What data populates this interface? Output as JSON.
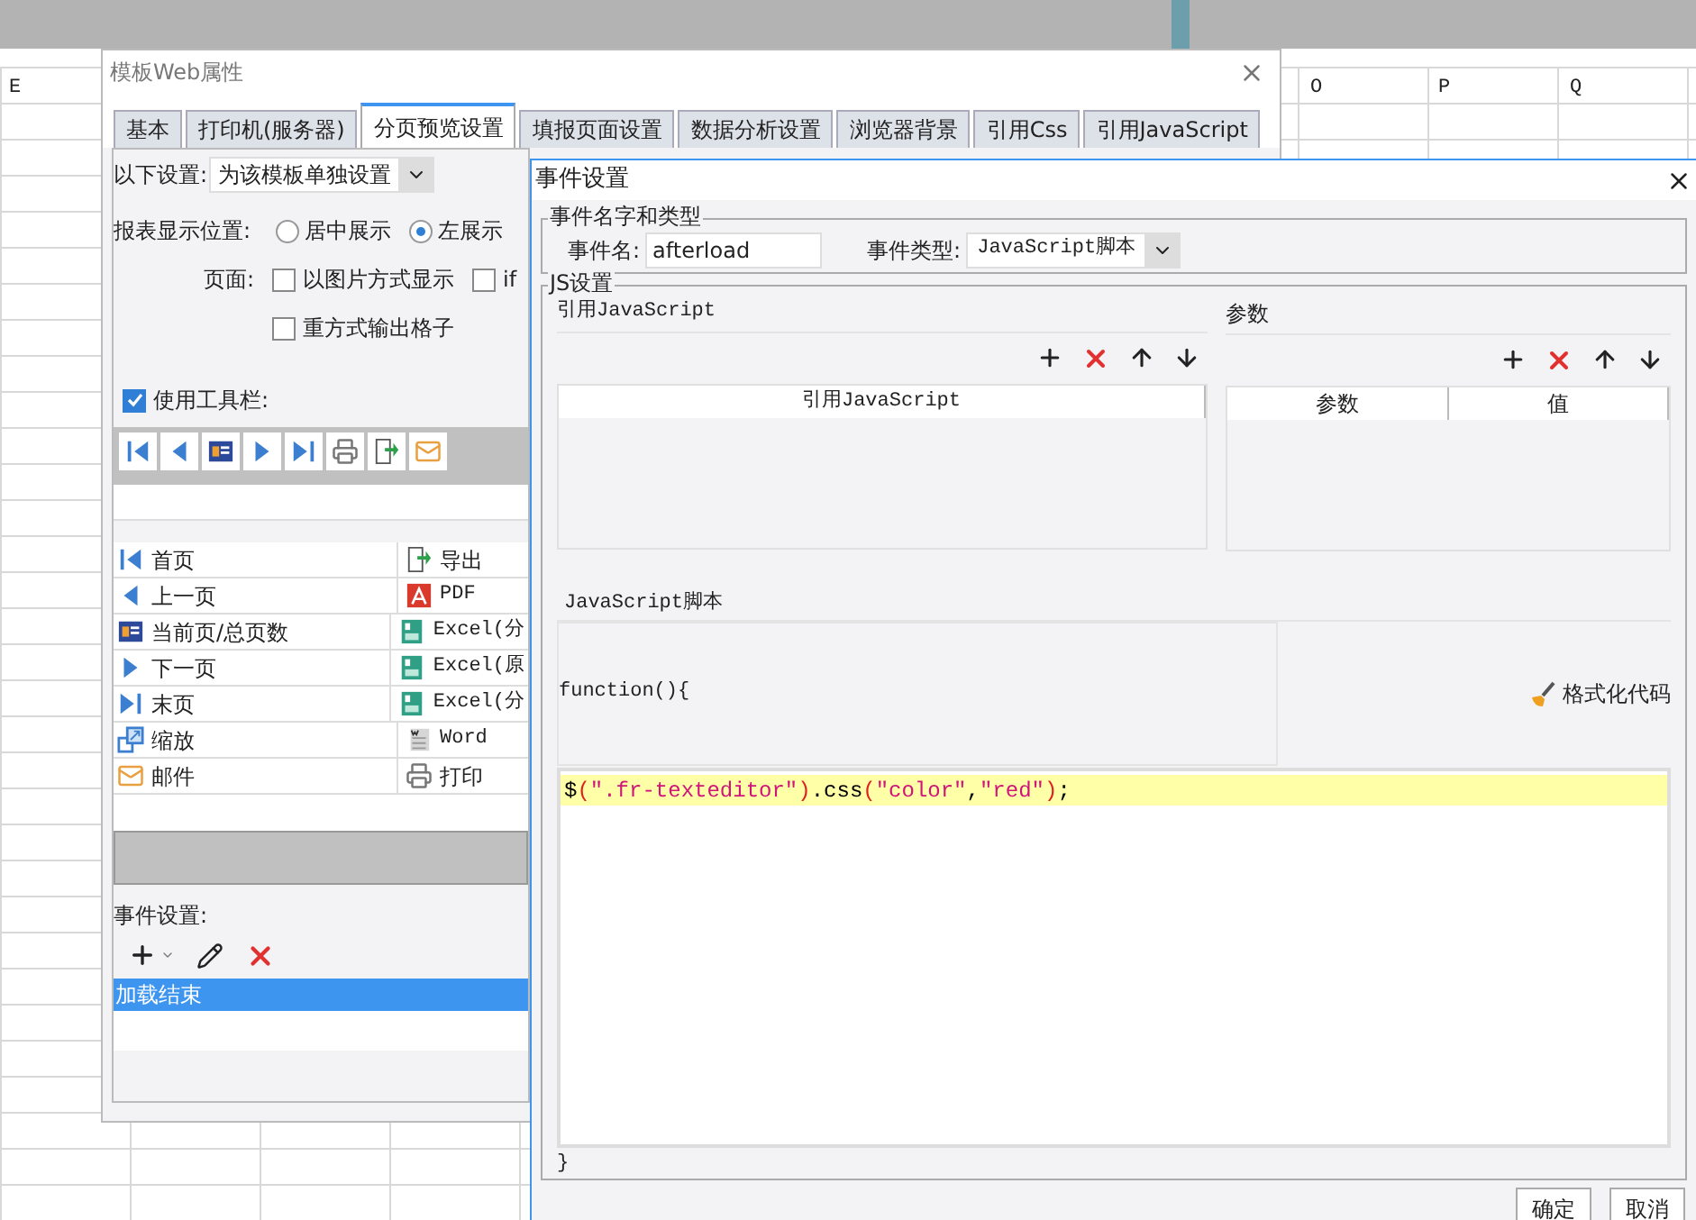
{
  "spreadsheet": {
    "column_headers": [
      "E",
      "O",
      "P",
      "Q"
    ]
  },
  "properties_window": {
    "title": "模板Web属性",
    "tabs": [
      {
        "label": "基本",
        "selected": false
      },
      {
        "label": "打印机(服务器)",
        "selected": false
      },
      {
        "label": "分页预览设置",
        "selected": true
      },
      {
        "label": "填报页面设置",
        "selected": false
      },
      {
        "label": "数据分析设置",
        "selected": false
      },
      {
        "label": "浏览器背景",
        "selected": false
      },
      {
        "label": "引用Css",
        "selected": false
      },
      {
        "label": "引用JavaScript",
        "selected": false
      }
    ],
    "following_settings": {
      "label": "以下设置:",
      "value": "为该模板单独设置"
    },
    "report_position": {
      "label": "报表显示位置:",
      "options": [
        {
          "label": "居中展示",
          "selected": false
        },
        {
          "label": "左展示",
          "selected": true
        }
      ]
    },
    "page": {
      "label": "页面:",
      "options": [
        {
          "label": "以图片方式显示",
          "checked": false
        },
        {
          "label": "if",
          "checked": false
        },
        {
          "label": "重方式输出格子",
          "checked": false
        }
      ]
    },
    "use_toolbar": {
      "label": "使用工具栏:",
      "checked": true
    },
    "toolbar": [
      {
        "kind": "first"
      },
      {
        "kind": "prev"
      },
      {
        "kind": "pageinfo"
      },
      {
        "kind": "next"
      },
      {
        "kind": "last"
      },
      {
        "kind": "print"
      },
      {
        "kind": "export"
      },
      {
        "kind": "mail"
      }
    ],
    "buttons": [
      [
        {
          "kind": "first",
          "label": "首页"
        },
        {
          "kind": "export",
          "label": "导出"
        }
      ],
      [
        {
          "kind": "prev",
          "label": "上一页"
        },
        {
          "kind": "pdf",
          "label": "PDF"
        }
      ],
      [
        {
          "kind": "pageinfo",
          "label": "当前页/总页数"
        },
        {
          "kind": "excel",
          "label": "Excel(分"
        }
      ],
      [
        {
          "kind": "next",
          "label": "下一页"
        },
        {
          "kind": "excel",
          "label": "Excel(原"
        }
      ],
      [
        {
          "kind": "last",
          "label": "末页"
        },
        {
          "kind": "excel",
          "label": "Excel(分"
        }
      ],
      [
        {
          "kind": "zoom",
          "label": "缩放"
        },
        {
          "kind": "word",
          "label": "Word"
        }
      ],
      [
        {
          "kind": "mail",
          "label": "邮件"
        },
        {
          "kind": "print",
          "label": "打印"
        }
      ]
    ],
    "event_settings": {
      "label": "事件设置:",
      "events": [
        {
          "label": "加载结束",
          "selected": true
        }
      ]
    }
  },
  "event_dialog": {
    "title": "事件设置",
    "name_type_group": {
      "title": "事件名字和类型",
      "name_label": "事件名:",
      "name_value": "afterload",
      "type_label": "事件类型:",
      "type_value": "JavaScript脚本"
    },
    "js_group": {
      "title": "JS设置",
      "ref_js": {
        "title": "引用JavaScript",
        "columns": [
          "引用JavaScript"
        ]
      },
      "params": {
        "title": "参数",
        "columns": [
          "参数",
          "值"
        ]
      },
      "script": {
        "title": "JavaScript脚本",
        "header": "function(){",
        "format_button": "格式化代码",
        "lines": [
          {
            "text": "$(\".fr-texteditor\").css(\"color\",\"red\");",
            "highlighted": true
          }
        ],
        "footer": "}"
      }
    },
    "buttons": [
      "确定",
      "取消"
    ]
  }
}
